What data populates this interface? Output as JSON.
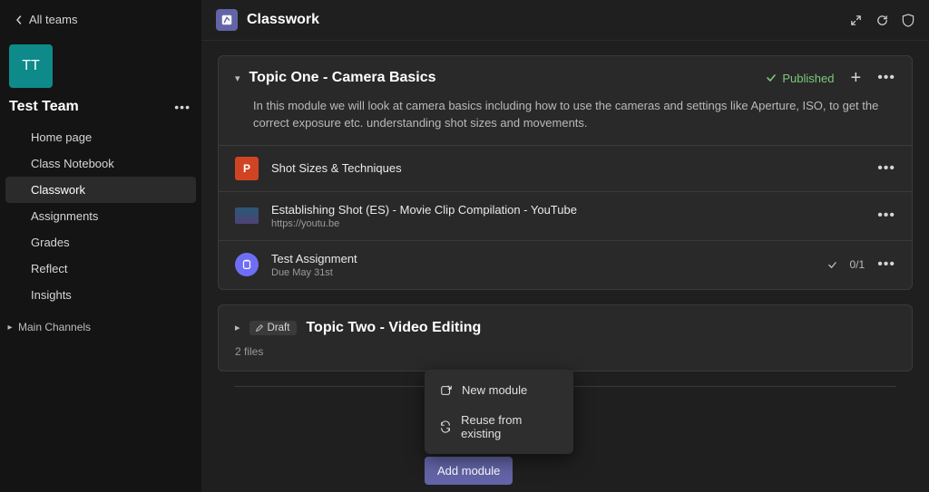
{
  "sidebar": {
    "all_teams": "All teams",
    "avatar_initials": "TT",
    "team_name": "Test Team",
    "nav": [
      {
        "label": "Home page"
      },
      {
        "label": "Class Notebook"
      },
      {
        "label": "Classwork"
      },
      {
        "label": "Assignments"
      },
      {
        "label": "Grades"
      },
      {
        "label": "Reflect"
      },
      {
        "label": "Insights"
      }
    ],
    "channels_label": "Main Channels"
  },
  "header": {
    "tab_title": "Classwork"
  },
  "topic_one": {
    "title": "Topic One - Camera Basics",
    "status": "Published",
    "description": "In this module we will look at camera basics including how to use the cameras and settings like Aperture, ISO, to get the correct exposure etc. understanding shot sizes and movements.",
    "item_ppt": {
      "title": "Shot Sizes & Techniques"
    },
    "item_yt": {
      "title": "Establishing Shot (ES) - Movie Clip Compilation - YouTube",
      "sub": "https://youtu.be"
    },
    "item_asgn": {
      "title": "Test Assignment",
      "sub": "Due May 31st",
      "progress": "0/1"
    }
  },
  "topic_two": {
    "draft_label": "Draft",
    "title": "Topic Two - Video Editing",
    "sub": "2 files"
  },
  "popup": {
    "new_module": "New module",
    "reuse": "Reuse from existing"
  },
  "add_module_label": "Add module"
}
